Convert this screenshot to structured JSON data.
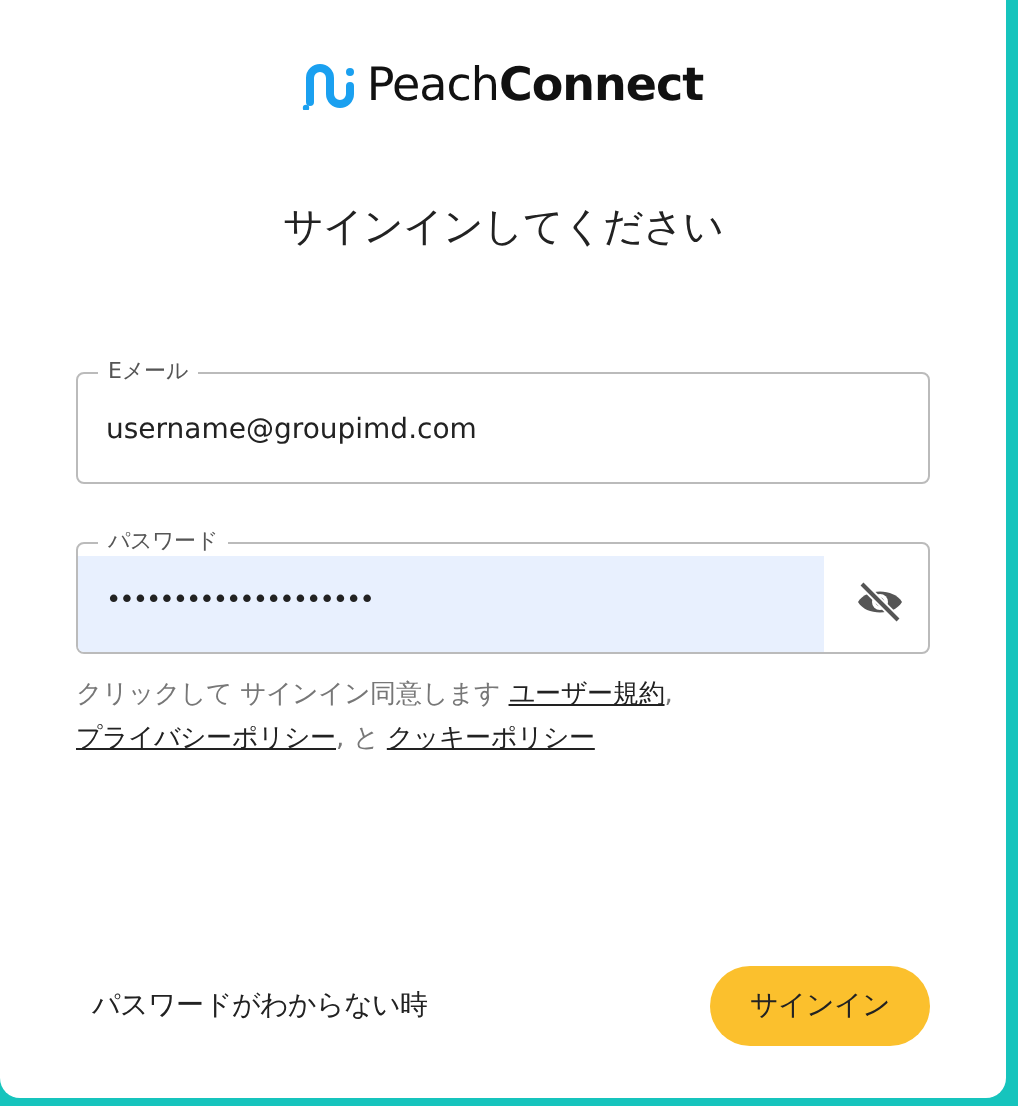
{
  "logo": {
    "light": "Peach",
    "bold": "Connect"
  },
  "title": "サインインしてください",
  "fields": [
    {
      "kind": "text",
      "label": "Eメール",
      "value": "username@groupimd.com",
      "autofilled": false
    },
    {
      "kind": "password",
      "label": "パスワード",
      "value": "••••••••••••••••••••",
      "autofilled": true
    }
  ],
  "legal": [
    {
      "kind": "text",
      "text": "クリックして サインイン同意します "
    },
    {
      "kind": "link",
      "text": "ユーザー規約"
    },
    {
      "kind": "text",
      "text": ", "
    },
    {
      "kind": "link",
      "text": "プライバシーポリシー"
    },
    {
      "kind": "text",
      "text": ", と "
    },
    {
      "kind": "link",
      "text": "クッキーポリシー"
    }
  ],
  "forgot_link": "パスワードがわからない時",
  "submit_button": "サインイン"
}
